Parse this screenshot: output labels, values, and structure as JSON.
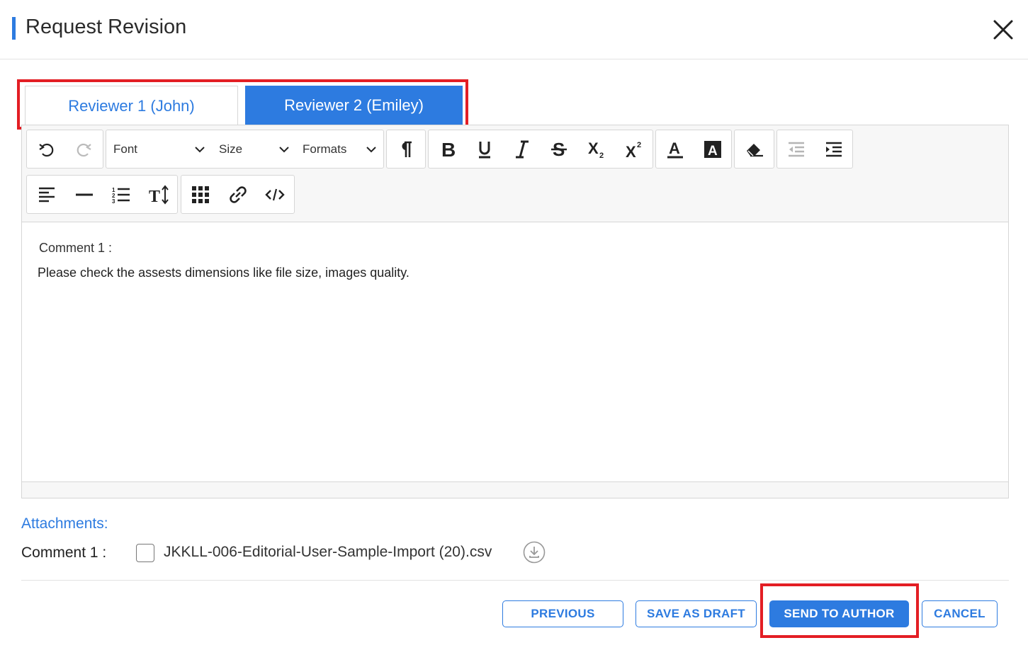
{
  "dialog": {
    "title": "Request Revision",
    "close_icon": "close-icon",
    "accent_color": "#2d7be0",
    "highlight_color": "#e31e24"
  },
  "tabs": [
    {
      "label": "Reviewer 1 (John)",
      "active": false
    },
    {
      "label": "Reviewer 2 (Emiley)",
      "active": true
    }
  ],
  "toolbar": {
    "font_label": "Font",
    "size_label": "Size",
    "formats_label": "Formats",
    "icons": [
      "undo-icon",
      "redo-icon",
      "paragraph-icon",
      "bold-icon",
      "underline-icon",
      "italic-icon",
      "strikethrough-icon",
      "subscript-icon",
      "superscript-icon",
      "font-color-icon",
      "background-color-icon",
      "eraser-icon",
      "outdent-icon",
      "indent-icon",
      "align-left-icon",
      "horizontal-line-icon",
      "ordered-list-icon",
      "line-height-icon",
      "table-icon",
      "link-icon",
      "code-view-icon"
    ]
  },
  "editor": {
    "line1": "Comment 1 :",
    "line2": "Please check the assests dimensions like file size, images quality."
  },
  "attachments": {
    "heading": "Attachments:",
    "label": "Comment 1 :",
    "file_name": "JKKLL-006-Editorial-User-Sample-Import (20).csv",
    "checked": false,
    "download_icon": "download-icon"
  },
  "footer": {
    "previous": "PREVIOUS",
    "save_draft": "SAVE AS DRAFT",
    "send_to_author": "SEND TO AUTHOR",
    "cancel": "CANCEL"
  }
}
